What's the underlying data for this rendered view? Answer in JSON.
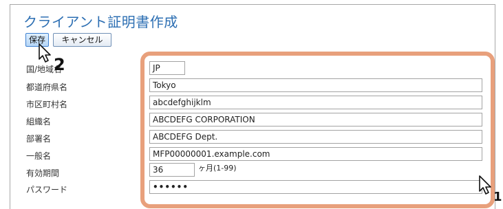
{
  "header": {
    "title": "クライアント証明書作成"
  },
  "toolbar": {
    "save_label": "保存",
    "cancel_label": "キャンセル"
  },
  "form": {
    "fields": [
      {
        "label": "国/地域名",
        "value": "JP"
      },
      {
        "label": "都道府県名",
        "value": "Tokyo"
      },
      {
        "label": "市区町村名",
        "value": "abcdefghijklm"
      },
      {
        "label": "組織名",
        "value": "ABCDEFG CORPORATION"
      },
      {
        "label": "部署名",
        "value": "ABCDEFG Dept."
      },
      {
        "label": "一般名",
        "value": "MFP00000001.example.com"
      },
      {
        "label": "有効期間",
        "value": "36",
        "unit": "ヶ月(1-99)"
      },
      {
        "label": "パスワード",
        "value": "••••••"
      }
    ]
  },
  "annotations": {
    "step1": "1",
    "step2": "2"
  },
  "colors": {
    "title": "#2d6fb3",
    "highlight": "#e8a07c",
    "button_border": "#6f8fb5"
  }
}
